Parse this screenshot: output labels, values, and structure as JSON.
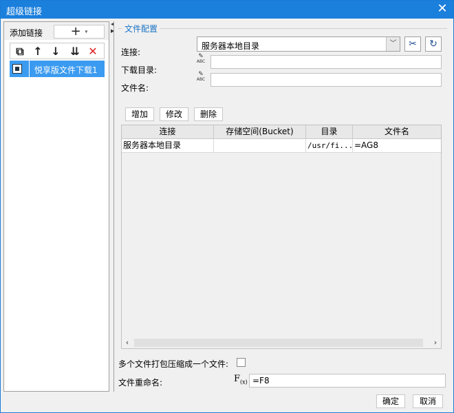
{
  "window": {
    "title": "超级链接",
    "close_glyph": "✕"
  },
  "left": {
    "add_label": "添加链接",
    "add_glyph": "+",
    "add_caret": "▾",
    "tools": [
      {
        "name": "copy-icon",
        "glyph": "⧉"
      },
      {
        "name": "move-up-icon",
        "glyph": "↑"
      },
      {
        "name": "move-down-icon",
        "glyph": "↓"
      },
      {
        "name": "sort-icon",
        "glyph": "⇊"
      },
      {
        "name": "delete-icon",
        "glyph": "✕",
        "color": "#e02020"
      }
    ],
    "items": [
      {
        "label": "悦享版文件下载1",
        "selected": true
      }
    ]
  },
  "right": {
    "section_title": "文件配置",
    "connection_label": "连接:",
    "connection_value": "服务器本地目录",
    "download_dir_label": "下载目录:",
    "download_dir_value": "",
    "file_name_label": "文件名:",
    "file_name_value": "",
    "buttons": {
      "add": "增加",
      "edit": "修改",
      "delete": "删除"
    },
    "table": {
      "headers": [
        "连接",
        "存储空间(Bucket)",
        "目录",
        "文件名"
      ],
      "rows": [
        [
          "服务器本地目录",
          "",
          "/usr/fi...",
          "=AG8"
        ]
      ]
    },
    "zip_label": "多个文件打包压缩成一个文件:",
    "zip_checked": false,
    "rename_label": "文件重命名:",
    "rename_value": "=F8"
  },
  "footer": {
    "ok": "确定",
    "cancel": "取消"
  },
  "colors": {
    "titlebar": "#1b7fdc",
    "selection": "#3b9bf0",
    "accent_text": "#1b74c4"
  }
}
